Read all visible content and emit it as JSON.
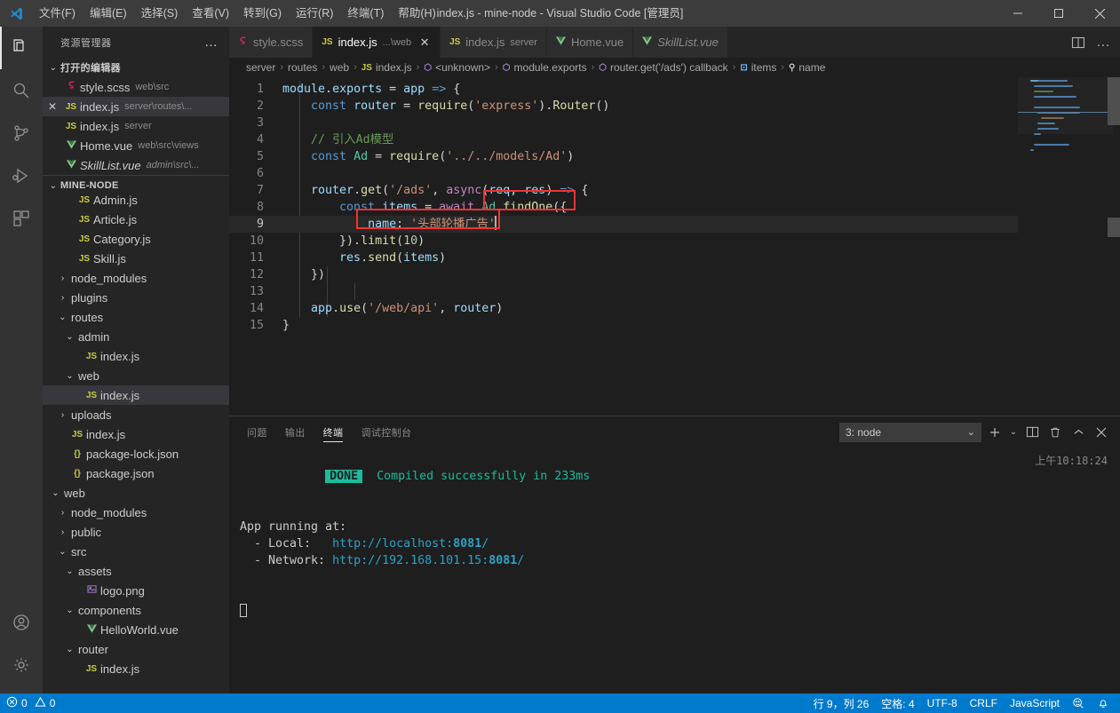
{
  "titlebar": {
    "window_title": "index.js - mine-node - Visual Studio Code [管理员]",
    "menu": [
      {
        "label": "文件(F)"
      },
      {
        "label": "编辑(E)"
      },
      {
        "label": "选择(S)"
      },
      {
        "label": "查看(V)"
      },
      {
        "label": "转到(G)"
      },
      {
        "label": "运行(R)"
      },
      {
        "label": "终端(T)"
      },
      {
        "label": "帮助(H)"
      }
    ],
    "minimize": "—",
    "maximize": "□",
    "close": "✕"
  },
  "activitybar": {
    "items": [
      {
        "name": "explorer-icon",
        "title": "资源管理器"
      },
      {
        "name": "search-icon",
        "title": "搜索"
      },
      {
        "name": "source-control-icon",
        "title": "源代码管理"
      },
      {
        "name": "run-debug-icon",
        "title": "运行和调试"
      },
      {
        "name": "extensions-icon",
        "title": "扩展"
      }
    ],
    "bottom": [
      {
        "name": "account-icon",
        "title": "帐户"
      },
      {
        "name": "settings-gear-icon",
        "title": "管理"
      }
    ]
  },
  "sidebar": {
    "header_title": "资源管理器",
    "more_actions": "…",
    "open_editors": {
      "label": "打开的编辑器",
      "chevron": "⌄",
      "items": [
        {
          "icon": "scss",
          "icon_glyph": "S",
          "name": "style.scss",
          "desc": "web\\src",
          "close": "",
          "selected": false,
          "italic": false
        },
        {
          "icon": "js",
          "icon_glyph": "JS",
          "name": "index.js",
          "desc": "server\\routes\\...",
          "close": "✕",
          "selected": true,
          "italic": false
        },
        {
          "icon": "js",
          "icon_glyph": "JS",
          "name": "index.js",
          "desc": "server",
          "close": "",
          "selected": false,
          "italic": false
        },
        {
          "icon": "vue",
          "icon_glyph": "V",
          "name": "Home.vue",
          "desc": "web\\src\\views",
          "close": "",
          "selected": false,
          "italic": false
        },
        {
          "icon": "vue",
          "icon_glyph": "V",
          "name": "SkillList.vue",
          "desc": "admin\\src\\...",
          "close": "",
          "selected": false,
          "italic": true
        }
      ]
    },
    "workspace": {
      "label": "MINE-NODE",
      "chevron": "⌄",
      "tree": [
        {
          "indent": 2,
          "twisty": "",
          "icon": "js",
          "icon_glyph": "JS",
          "label": "Admin.js",
          "selected": false
        },
        {
          "indent": 2,
          "twisty": "",
          "icon": "js",
          "icon_glyph": "JS",
          "label": "Article.js",
          "selected": false
        },
        {
          "indent": 2,
          "twisty": "",
          "icon": "js",
          "icon_glyph": "JS",
          "label": "Category.js",
          "selected": false
        },
        {
          "indent": 2,
          "twisty": "",
          "icon": "js",
          "icon_glyph": "JS",
          "label": "Skill.js",
          "selected": false
        },
        {
          "indent": 1,
          "twisty": "›",
          "icon": "none",
          "icon_glyph": "",
          "label": "node_modules",
          "selected": false
        },
        {
          "indent": 1,
          "twisty": "›",
          "icon": "none",
          "icon_glyph": "",
          "label": "plugins",
          "selected": false
        },
        {
          "indent": 1,
          "twisty": "⌄",
          "icon": "none",
          "icon_glyph": "",
          "label": "routes",
          "selected": false
        },
        {
          "indent": 2,
          "twisty": "⌄",
          "icon": "none",
          "icon_glyph": "",
          "label": "admin",
          "selected": false
        },
        {
          "indent": 3,
          "twisty": "",
          "icon": "js",
          "icon_glyph": "JS",
          "label": "index.js",
          "selected": false
        },
        {
          "indent": 2,
          "twisty": "⌄",
          "icon": "none",
          "icon_glyph": "",
          "label": "web",
          "selected": false
        },
        {
          "indent": 3,
          "twisty": "",
          "icon": "js",
          "icon_glyph": "JS",
          "label": "index.js",
          "selected": true
        },
        {
          "indent": 1,
          "twisty": "›",
          "icon": "none",
          "icon_glyph": "",
          "label": "uploads",
          "selected": false
        },
        {
          "indent": 1,
          "twisty": "",
          "icon": "js",
          "icon_glyph": "JS",
          "label": "index.js",
          "selected": false
        },
        {
          "indent": 1,
          "twisty": "",
          "icon": "json",
          "icon_glyph": "{}",
          "label": "package-lock.json",
          "selected": false
        },
        {
          "indent": 1,
          "twisty": "",
          "icon": "json",
          "icon_glyph": "{}",
          "label": "package.json",
          "selected": false
        },
        {
          "indent": 0,
          "twisty": "⌄",
          "icon": "none",
          "icon_glyph": "",
          "label": "web",
          "selected": false
        },
        {
          "indent": 1,
          "twisty": "›",
          "icon": "none",
          "icon_glyph": "",
          "label": "node_modules",
          "selected": false
        },
        {
          "indent": 1,
          "twisty": "›",
          "icon": "none",
          "icon_glyph": "",
          "label": "public",
          "selected": false
        },
        {
          "indent": 1,
          "twisty": "⌄",
          "icon": "none",
          "icon_glyph": "",
          "label": "src",
          "selected": false
        },
        {
          "indent": 2,
          "twisty": "⌄",
          "icon": "none",
          "icon_glyph": "",
          "label": "assets",
          "selected": false
        },
        {
          "indent": 3,
          "twisty": "",
          "icon": "img",
          "icon_glyph": "▣",
          "label": "logo.png",
          "selected": false
        },
        {
          "indent": 2,
          "twisty": "⌄",
          "icon": "none",
          "icon_glyph": "",
          "label": "components",
          "selected": false
        },
        {
          "indent": 3,
          "twisty": "",
          "icon": "vue",
          "icon_glyph": "V",
          "label": "HelloWorld.vue",
          "selected": false
        },
        {
          "indent": 2,
          "twisty": "⌄",
          "icon": "none",
          "icon_glyph": "",
          "label": "router",
          "selected": false
        },
        {
          "indent": 3,
          "twisty": "",
          "icon": "js",
          "icon_glyph": "JS",
          "label": "index.js",
          "selected": false
        }
      ]
    }
  },
  "tabs": [
    {
      "icon": "scss",
      "icon_glyph": "S",
      "name": "style.scss",
      "desc": "",
      "active": false,
      "closable": false,
      "italic": false
    },
    {
      "icon": "js",
      "icon_glyph": "JS",
      "name": "index.js",
      "desc": "...\\web",
      "active": true,
      "closable": true,
      "italic": false
    },
    {
      "icon": "js",
      "icon_glyph": "JS",
      "name": "index.js",
      "desc": "server",
      "active": false,
      "closable": false,
      "italic": false
    },
    {
      "icon": "vue",
      "icon_glyph": "V",
      "name": "Home.vue",
      "desc": "",
      "active": false,
      "closable": false,
      "italic": false
    },
    {
      "icon": "vue",
      "icon_glyph": "V",
      "name": "SkillList.vue",
      "desc": "",
      "active": false,
      "closable": false,
      "italic": true
    }
  ],
  "tabbar_actions": [
    {
      "name": "split-editor-icon",
      "glyph": "▯▯"
    },
    {
      "name": "more-actions-icon",
      "glyph": "…"
    }
  ],
  "breadcrumb": [
    {
      "label": "server",
      "icon": "",
      "icon_glyph": ""
    },
    {
      "label": "routes",
      "icon": "",
      "icon_glyph": ""
    },
    {
      "label": "web",
      "icon": "",
      "icon_glyph": ""
    },
    {
      "label": "index.js",
      "icon": "js",
      "icon_glyph": "JS"
    },
    {
      "label": "<unknown>",
      "icon": "sym-module",
      "icon_glyph": "◈"
    },
    {
      "label": "module.exports",
      "icon": "sym-module",
      "icon_glyph": "◈"
    },
    {
      "label": "router.get('/ads') callback",
      "icon": "sym-module",
      "icon_glyph": "◈"
    },
    {
      "label": "items",
      "icon": "sym-var",
      "icon_glyph": "⊡"
    },
    {
      "label": "name",
      "icon": "sym-key",
      "icon_glyph": "⚲"
    }
  ],
  "breadcrumb_separator": "›",
  "code": {
    "language": "JavaScript",
    "lines": [
      {
        "n": "1",
        "current": false
      },
      {
        "n": "2",
        "current": false
      },
      {
        "n": "3",
        "current": false
      },
      {
        "n": "4",
        "current": false
      },
      {
        "n": "5",
        "current": false
      },
      {
        "n": "6",
        "current": false
      },
      {
        "n": "7",
        "current": false
      },
      {
        "n": "8",
        "current": false
      },
      {
        "n": "9",
        "current": true
      },
      {
        "n": "10",
        "current": false
      },
      {
        "n": "11",
        "current": false
      },
      {
        "n": "12",
        "current": false
      },
      {
        "n": "13",
        "current": false
      },
      {
        "n": "14",
        "current": false
      },
      {
        "n": "15",
        "current": false
      }
    ],
    "text": [
      "module.exports = app => {",
      "    const router = require('express').Router()",
      "",
      "    // 引入Ad模型",
      "    const Ad = require('../../models/Ad')",
      "",
      "    router.get('/ads', async(req, res) => {",
      "        const items = await Ad.findOne({",
      "            name: '头部轮播广告'",
      "        }).limit(10)",
      "        res.send(items)",
      "    })",
      "",
      "    app.use('/web/api', router)",
      "}"
    ]
  },
  "annotations": [
    {
      "name": "annotation-findone-box",
      "color": "#f03232"
    },
    {
      "name": "annotation-name-box",
      "color": "#f03232"
    }
  ],
  "panel": {
    "tabs": [
      {
        "label": "问题",
        "active": false
      },
      {
        "label": "输出",
        "active": false
      },
      {
        "label": "终端",
        "active": true
      },
      {
        "label": "调试控制台",
        "active": false
      }
    ],
    "terminal_select": {
      "value": "3: node",
      "chevron": "⌄"
    },
    "actions": [
      {
        "name": "new-terminal-icon",
        "glyph": "+"
      },
      {
        "name": "new-terminal-dropdown-icon",
        "glyph": "⌄"
      },
      {
        "name": "split-terminal-icon",
        "glyph": "▯▯"
      },
      {
        "name": "kill-terminal-icon",
        "glyph": "🗑"
      },
      {
        "name": "maximize-panel-icon",
        "glyph": "^"
      },
      {
        "name": "close-panel-icon",
        "glyph": "✕"
      }
    ],
    "terminal": {
      "badge": "DONE",
      "badge_message": "Compiled successfully in 233ms",
      "timestamp": "上午10:18:24",
      "app_running_label": "App running at:",
      "local_label": "  - Local:   ",
      "local_url_prefix": "http://localhost:",
      "local_port": "8081",
      "local_url_suffix": "/",
      "network_label": "  - Network: ",
      "network_url_prefix": "http://192.168.101.15:",
      "network_port": "8081",
      "network_url_suffix": "/"
    }
  },
  "statusbar": {
    "left": [
      {
        "name": "problems-errors",
        "glyph": "⊗",
        "label": "0"
      },
      {
        "name": "problems-warnings",
        "glyph": "⚠",
        "label": "0"
      }
    ],
    "right": [
      {
        "name": "cursor-position",
        "label": "行 9，列 26"
      },
      {
        "name": "indentation",
        "label": "空格: 4"
      },
      {
        "name": "encoding",
        "label": "UTF-8"
      },
      {
        "name": "eol",
        "label": "CRLF"
      },
      {
        "name": "language-mode",
        "label": "JavaScript"
      },
      {
        "name": "feedback-icon",
        "label": "☺"
      },
      {
        "name": "notifications-bell-icon",
        "label": "🔔"
      }
    ]
  },
  "colors": {
    "accent": "#007acc",
    "annotation_red": "#f03232",
    "titlebar_bg": "#3c3c3c",
    "sidebar_bg": "#252526",
    "editor_bg": "#1e1e1e",
    "activitybar_bg": "#333333",
    "done_badge": "#1abc9c"
  }
}
